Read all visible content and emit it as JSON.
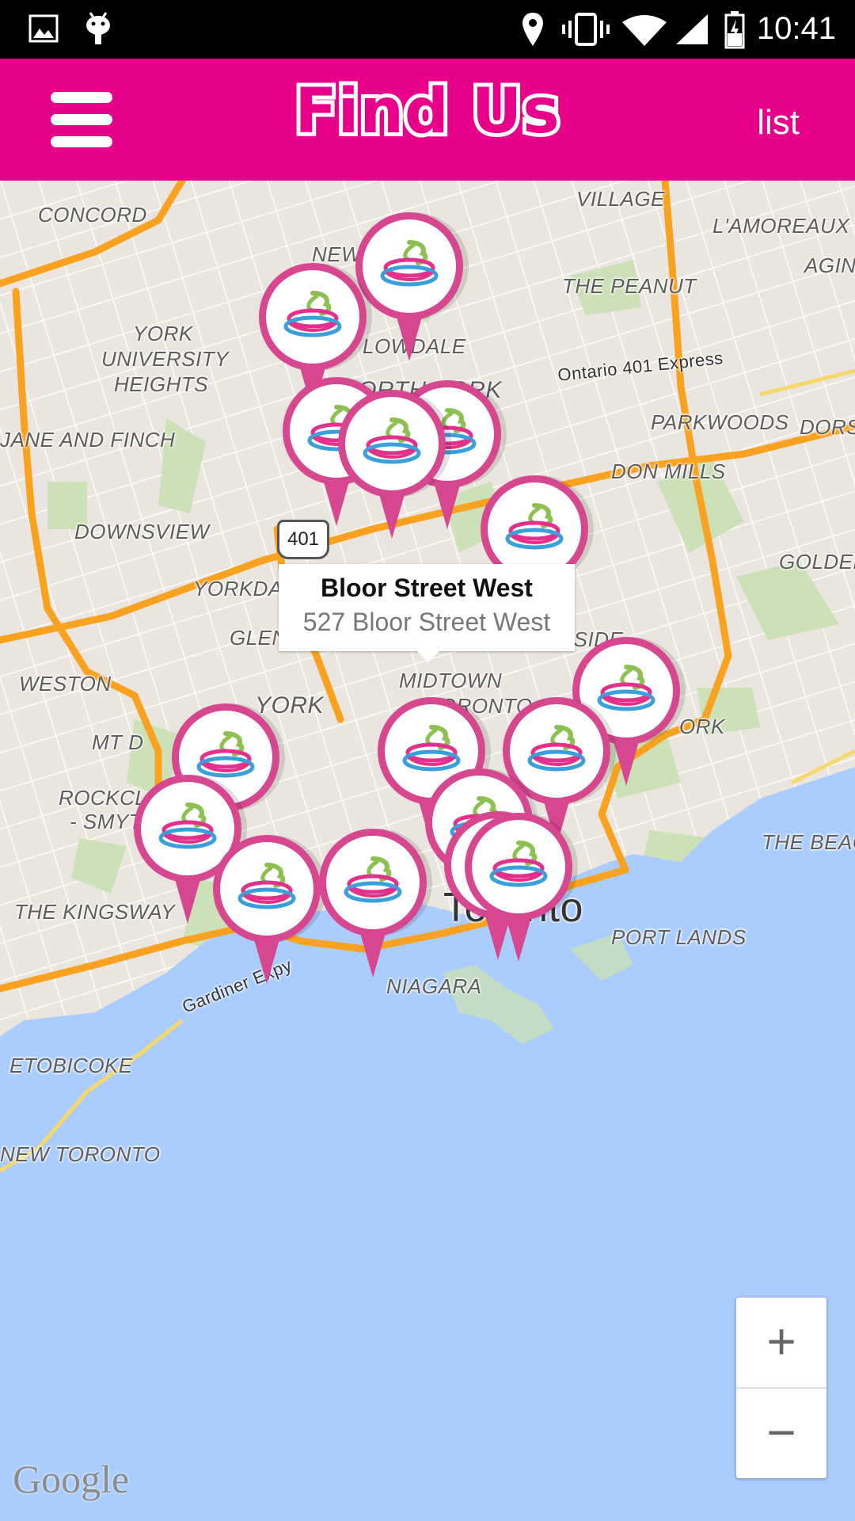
{
  "status_bar": {
    "time": "10:41",
    "left_icons": [
      "image-icon",
      "android-icon"
    ],
    "right_icons": [
      "location-icon",
      "vibrate-icon",
      "wifi-icon",
      "signal-icon",
      "battery-icon"
    ]
  },
  "app_bar": {
    "title": "Find Us",
    "list_label": "list",
    "menu_icon": "hamburger-menu-icon",
    "color": "#e8008a"
  },
  "map": {
    "place_labels": {
      "concord": "CONCORD",
      "village": "VILLAGE",
      "lamoreaux": "L'AMOREAUX",
      "agincourt": "AGIN",
      "the_peanut": "THE PEANUT",
      "york_university": "YORK",
      "york_university2": "UNIVERSITY",
      "york_university3": "HEIGHTS",
      "north_york": "NORTH YORK",
      "newtonbrook": "NEW",
      "willowdale": "LOWDALE",
      "jane_finch": "JANE AND FINCH",
      "parkwoods": "PARKWOODS",
      "dorset": "DORS",
      "don_mills": "DON MILLS",
      "downsview": "DOWNSVIEW",
      "golden_mile": "GOLDEN",
      "yorkdale": "YORKDAL",
      "glen_park": "GLEN",
      "leaside": "LEASIDE",
      "weston": "WESTON",
      "york": "YORK",
      "midtown": "MIDTOWN",
      "midtown2": "TORONTO",
      "east_york": "ORK",
      "mt_dennis": "MT D",
      "rockcliffe": "ROCKCL",
      "rockcliffe2": "- SMYT",
      "the_beach": "THE BEAC",
      "the_kingsway": "THE KINGSWAY",
      "toronto": "Toronto",
      "port_lands": "PORT LANDS",
      "niagara": "NIAGARA",
      "etobicoke": "ETOBICOKE",
      "new_toronto": "NEW TORONTO",
      "ontario_401": "Ontario 401 Express",
      "gardiner": "Gardiner Expy",
      "hwy_401": "401"
    },
    "callout": {
      "name": "Bloor Street West",
      "address": "527 Bloor Street West"
    },
    "pin_count": 16,
    "pin_icon": "frozen-yogurt-swirl-icon",
    "zoom_in_label": "+",
    "zoom_out_label": "−",
    "attribution": "Google",
    "colors": {
      "water": "#abcdfd",
      "land": "#eae6df",
      "highway": "#f8a21f",
      "park": "#c9e0b4",
      "pin": "#d6478f"
    }
  }
}
